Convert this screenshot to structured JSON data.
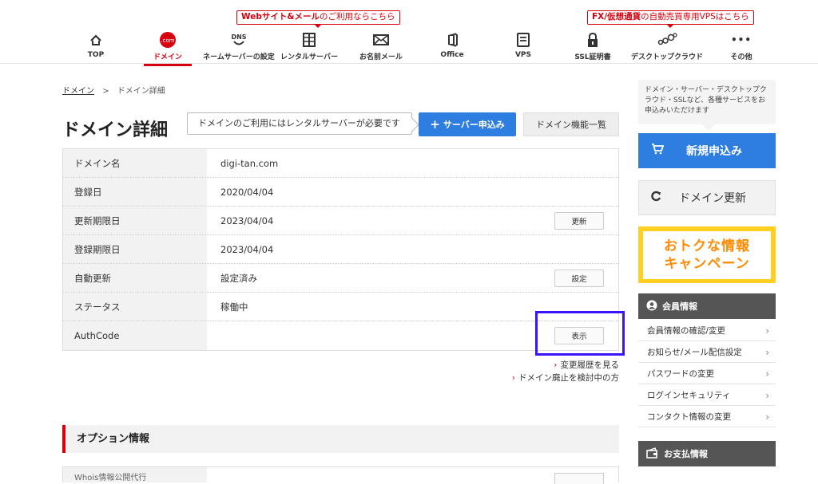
{
  "header": {
    "promo_web": {
      "bold": "Webサイト&メール",
      "text": "のご利用ならこちら"
    },
    "promo_vps": {
      "bold": "FX/仮想通貨",
      "text": "の自動売買専用VPSはこちら"
    },
    "nav": [
      {
        "label": "TOP",
        "icon": "home-icon"
      },
      {
        "label": "ドメイン",
        "icon": "dotcom-icon",
        "icon_text": ".com",
        "active": true
      },
      {
        "label": "ネームサーバーの設定",
        "icon": "dns-icon",
        "icon_text": "DNS"
      },
      {
        "label": "レンタルサーバー",
        "icon": "server-icon"
      },
      {
        "label": "お名前メール",
        "icon": "mail-icon"
      },
      {
        "label": "Office",
        "icon": "office-icon"
      },
      {
        "label": "VPS",
        "icon": "vps-icon"
      },
      {
        "label": "SSL証明書",
        "icon": "lock-icon"
      },
      {
        "label": "デスクトップクラウド",
        "icon": "cloud-icon"
      },
      {
        "label": "その他",
        "icon": "more-icon",
        "icon_text": "•••"
      }
    ]
  },
  "breadcrumb": {
    "parent": "ドメイン",
    "separator": ">",
    "current": "ドメイン詳細"
  },
  "page_title": "ドメイン詳細",
  "notice": "ドメインのご利用にはレンタルサーバーが必要です",
  "buttons": {
    "server_apply": "サーバー申込み",
    "server_apply_icon": "+",
    "domain_features": "ドメイン機能一覧"
  },
  "domain_info": [
    {
      "label": "ドメイン名",
      "value": "digi-tan.com"
    },
    {
      "label": "登録日",
      "value": "2020/04/04"
    },
    {
      "label": "更新期限日",
      "value": "2023/04/04",
      "action": "更新"
    },
    {
      "label": "登録期限日",
      "value": "2023/04/04"
    },
    {
      "label": "自動更新",
      "value": "設定済み",
      "action": "設定"
    },
    {
      "label": "ステータス",
      "value": "稼働中"
    },
    {
      "label": "AuthCode",
      "value": "",
      "action": "表示"
    }
  ],
  "links": {
    "history": "変更履歴を見る",
    "abolish": "ドメイン廃止を検討中の方",
    "arrow": "›"
  },
  "options_section": {
    "title": "オプション情報",
    "first_row_label": "Whois情報公開代行"
  },
  "sidebar": {
    "bubble": "ドメイン・サーバー・デスクトップクラウド・SSLなど、各種サービスをお申込みいただけます",
    "new_apply": "新規申込み",
    "renew": "ドメイン更新",
    "campaign": {
      "line1": "おトクな情報",
      "line2": "キャンペーン"
    },
    "member": {
      "title": "会員情報",
      "items": [
        "会員情報の確認/変更",
        "お知らせ/メール配信設定",
        "パスワードの変更",
        "ログインセキュリティ",
        "コンタクト情報の変更"
      ]
    },
    "payment": {
      "title": "お支払情報"
    },
    "chevron": "›"
  },
  "colors": {
    "brand_red": "#d8000f",
    "primary_blue": "#2e7de1",
    "highlight": "#3a13ff",
    "campaign_yellow": "#ffcf21"
  }
}
